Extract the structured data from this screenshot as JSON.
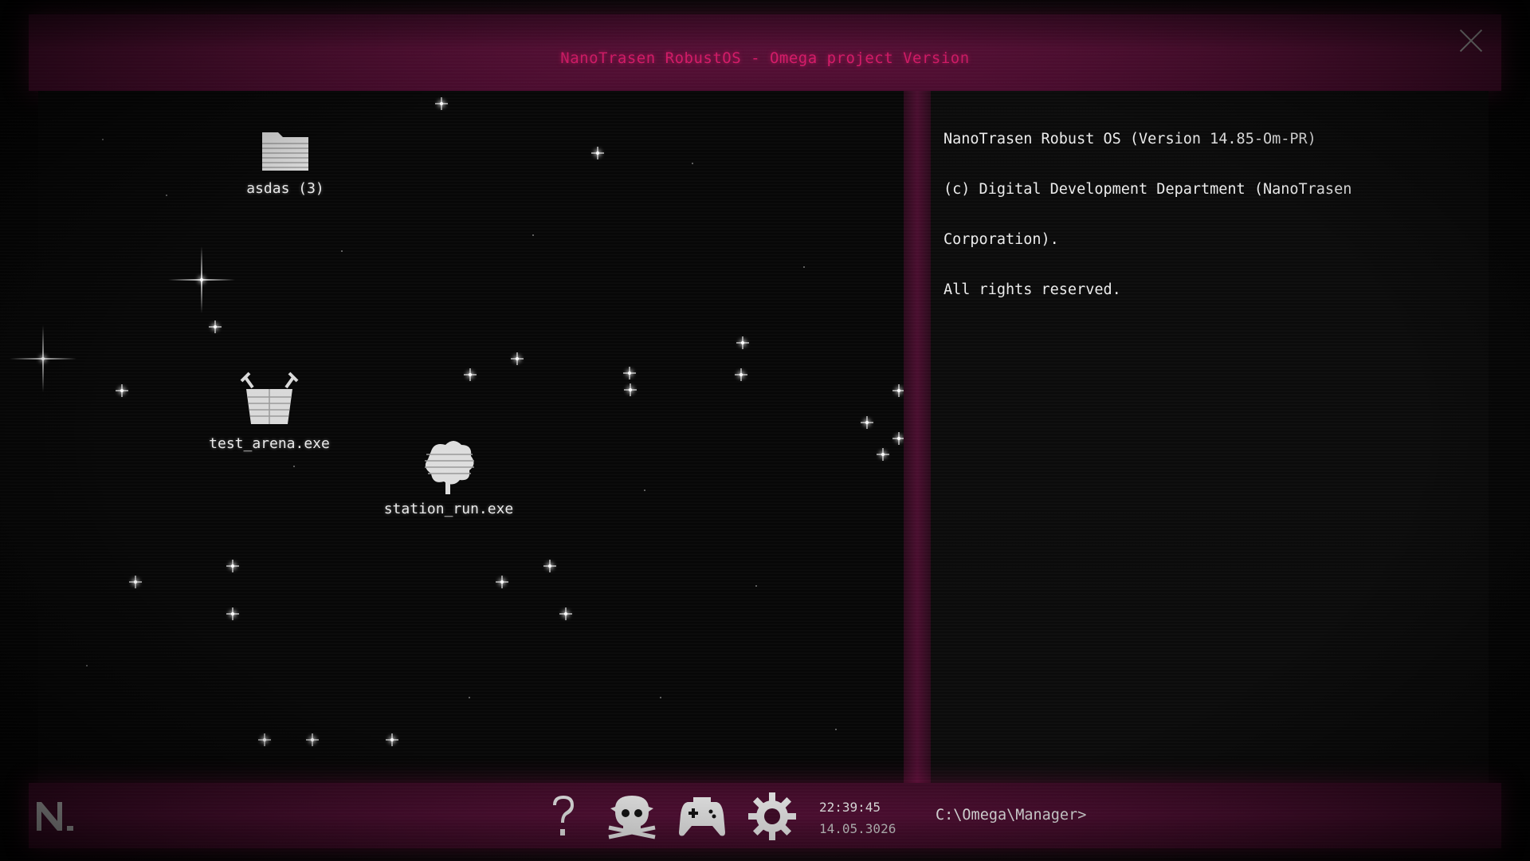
{
  "window": {
    "title": "NanoTrasen RobustOS - Omega project Version",
    "close_icon": "close-icon"
  },
  "desktop": {
    "icons": [
      {
        "label": "asdas (3)",
        "icon": "folder-icon"
      },
      {
        "label": "test_arena.exe",
        "icon": "arena-bucket-icon"
      },
      {
        "label": "station_run.exe",
        "icon": "station-run-icon"
      }
    ]
  },
  "terminal": {
    "lines": [
      "NanoTrasen Robust OS (Version 14.85-Om-PR)",
      "(c) Digital Development Department (NanoTrasen",
      "Corporation).",
      "All rights reserved."
    ],
    "prompt": "C:\\Omega\\Manager>"
  },
  "taskbar": {
    "logo": "nanotrasen-logo",
    "buttons": [
      {
        "name": "help-button",
        "icon": "question-mark-icon"
      },
      {
        "name": "syndicate-button",
        "icon": "skull-icon"
      },
      {
        "name": "gamepad-button",
        "icon": "gamepad-icon"
      },
      {
        "name": "settings-button",
        "icon": "gear-icon"
      }
    ],
    "clock": {
      "time": "22:39:45",
      "date": "14.05.3026"
    }
  },
  "colors": {
    "accent": "#d81b6a",
    "frame": "#4a0c2e",
    "background": "#070707",
    "text": "#ececec"
  }
}
